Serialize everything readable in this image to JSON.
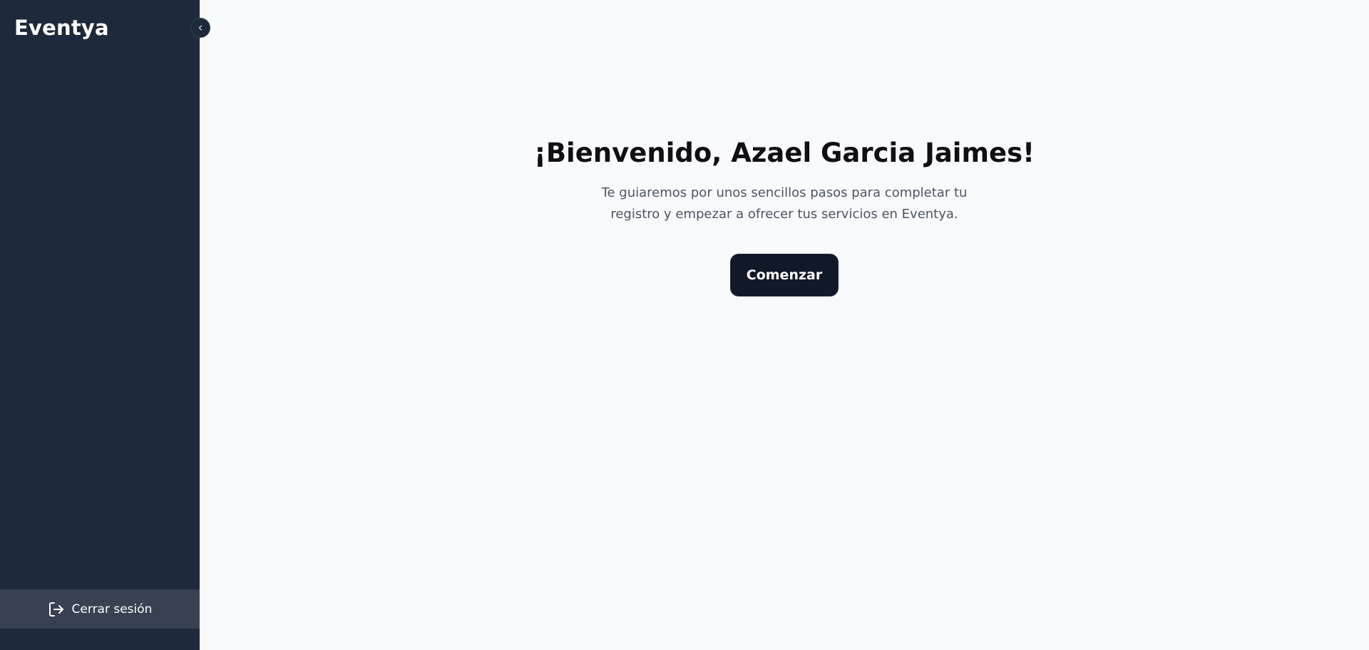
{
  "sidebar": {
    "brand": "Eventya",
    "collapse_icon": "chevron-left-icon",
    "logout": {
      "label": "Cerrar sesión",
      "icon": "logout-icon"
    }
  },
  "main": {
    "title": "¡Bienvenido, Azael Garcia Jaimes!",
    "description": "Te guiaremos por unos sencillos pasos para completar tu registro y empezar a ofrecer tus servicios en Eventya.",
    "start_button": "Comenzar"
  },
  "colors": {
    "sidebar_bg": "#1e293b",
    "logout_bg": "#374151",
    "page_bg": "#f8fafc",
    "button_bg": "#111827"
  }
}
